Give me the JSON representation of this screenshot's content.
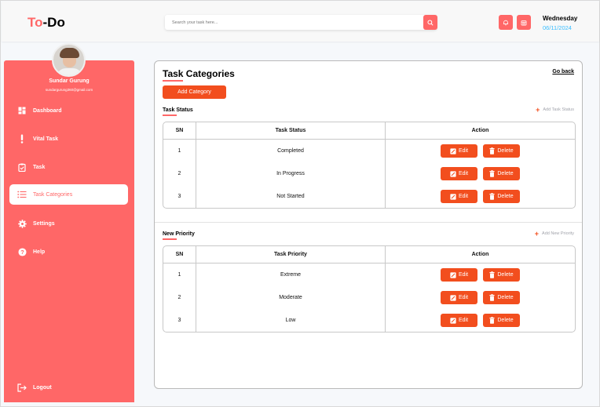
{
  "header": {
    "logo_part1": "To",
    "logo_part2": "-Do",
    "search_placeholder": "Search your task here...",
    "day": "Wednesday",
    "date": "06/11/2024"
  },
  "user": {
    "name": "Sundar Gurung",
    "email": "sundargurung360@gmail.com"
  },
  "sidebar": {
    "items": [
      {
        "label": "Dashboard",
        "icon": "dashboard-icon"
      },
      {
        "label": "Vital Task",
        "icon": "exclamation-icon"
      },
      {
        "label": "Task",
        "icon": "clipboard-check-icon"
      },
      {
        "label": "Task Categories",
        "icon": "list-icon"
      },
      {
        "label": "Settings",
        "icon": "gear-icon"
      },
      {
        "label": "Help",
        "icon": "help-icon"
      }
    ],
    "logout_label": "Logout"
  },
  "main": {
    "title": "Task Categories",
    "go_back": "Go back",
    "add_category": "Add Category",
    "task_status": {
      "title": "Task Status",
      "add_label": "Add Task Status",
      "headers": [
        "SN",
        "Task Status",
        "Action"
      ],
      "rows": [
        {
          "sn": "1",
          "name": "Completed"
        },
        {
          "sn": "2",
          "name": "In Progress"
        },
        {
          "sn": "3",
          "name": "Not Started"
        }
      ]
    },
    "priority": {
      "title": "New Priority",
      "add_label": "Add New Priority",
      "headers": [
        "SN",
        "Task Priority",
        "Action"
      ],
      "rows": [
        {
          "sn": "1",
          "name": "Extreme"
        },
        {
          "sn": "2",
          "name": "Moderate"
        },
        {
          "sn": "3",
          "name": "Low"
        }
      ]
    },
    "edit_label": "Edit",
    "delete_label": "Delete"
  },
  "colors": {
    "accent": "#ff6767",
    "button": "#f24e1e",
    "date": "#3abeff"
  }
}
